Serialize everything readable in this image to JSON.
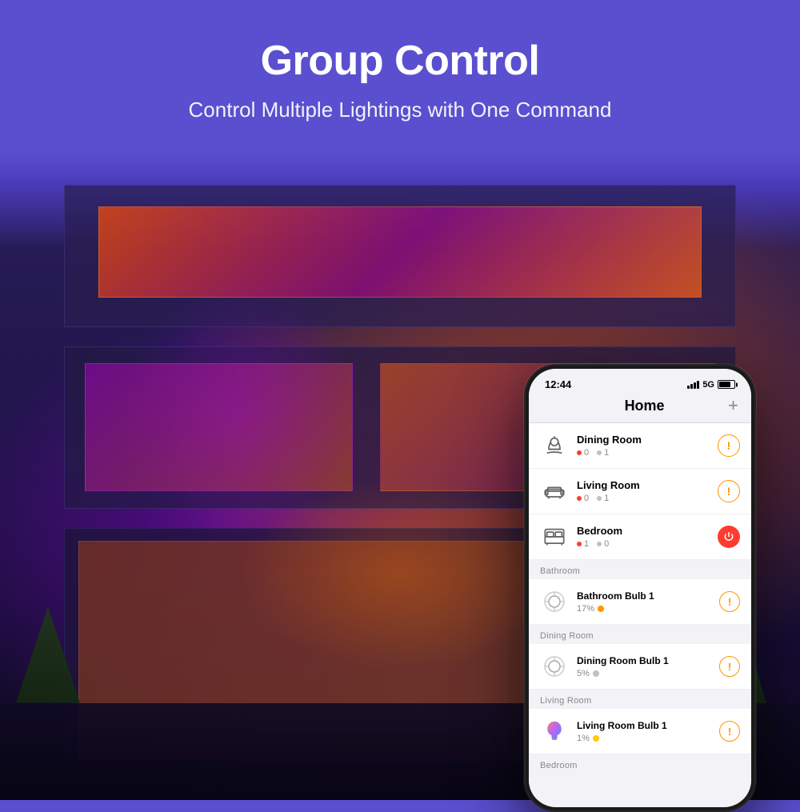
{
  "header": {
    "title": "Group Control",
    "subtitle": "Control Multiple Lightings with One Command"
  },
  "phone": {
    "status_bar": {
      "time": "12:44",
      "signal": "5G"
    },
    "app": {
      "title": "Home",
      "add_button": "+"
    },
    "rooms": [
      {
        "id": "dining-room",
        "name": "Dining Room",
        "icon": "dining",
        "stat1_label": "0",
        "stat2_label": "1",
        "action_type": "alert"
      },
      {
        "id": "living-room",
        "name": "Living Room",
        "icon": "sofa",
        "stat1_label": "0",
        "stat2_label": "1",
        "action_type": "alert"
      },
      {
        "id": "bedroom",
        "name": "Bedroom",
        "icon": "bed",
        "stat1_label": "1",
        "stat2_label": "0",
        "action_type": "power"
      }
    ],
    "sections": [
      {
        "label": "Bathroom",
        "devices": [
          {
            "name": "Bathroom Bulb 1",
            "status_pct": "17%",
            "dot_color": "#ff9500",
            "icon_type": "circle-bulb",
            "action_type": "alert"
          }
        ]
      },
      {
        "label": "Dining Room",
        "devices": [
          {
            "name": "Dining Room Bulb 1",
            "status_pct": "5%",
            "dot_color": "#c0c0c0",
            "icon_type": "circle-bulb",
            "action_type": "alert"
          }
        ]
      },
      {
        "label": "Living Room",
        "devices": [
          {
            "name": "Living Room Bulb 1",
            "status_pct": "1%",
            "dot_color": "#ffcc00",
            "icon_type": "color-bulb",
            "action_type": "alert"
          }
        ]
      },
      {
        "label": "Bedroom",
        "devices": []
      }
    ]
  }
}
